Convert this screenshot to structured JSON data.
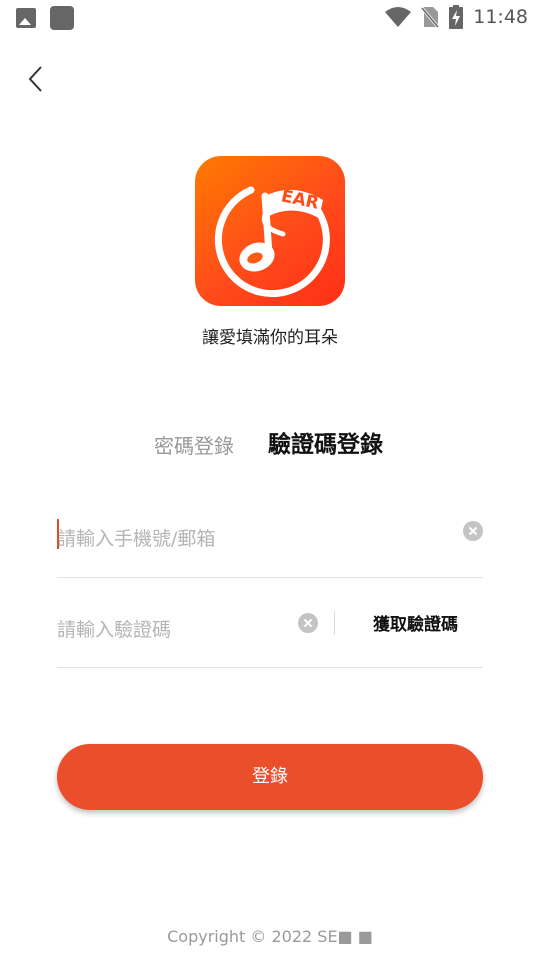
{
  "status_bar": {
    "time": "11:48",
    "icons": [
      "image-icon",
      "app-square-icon",
      "wifi-icon",
      "no-sim-icon",
      "battery-charging-icon"
    ]
  },
  "header": {
    "back_icon": "chevron-left-icon"
  },
  "logo": {
    "text": "EAR",
    "brand_color": "#ff4b1b"
  },
  "tagline": "讓愛填滿你的耳朵",
  "tabs": {
    "password_login": "密碼登錄",
    "code_login": "驗證碼登錄",
    "active": "code_login"
  },
  "form": {
    "phone_placeholder": "請輸入手機號/郵箱",
    "phone_value": "",
    "code_placeholder": "請輸入驗證碼",
    "code_value": "",
    "get_code_label": "獲取驗證碼"
  },
  "login_button": {
    "label": "登錄",
    "color": "#eb4e2a"
  },
  "footer": {
    "copyright": "Copyright © 2022 SE■ ■"
  }
}
